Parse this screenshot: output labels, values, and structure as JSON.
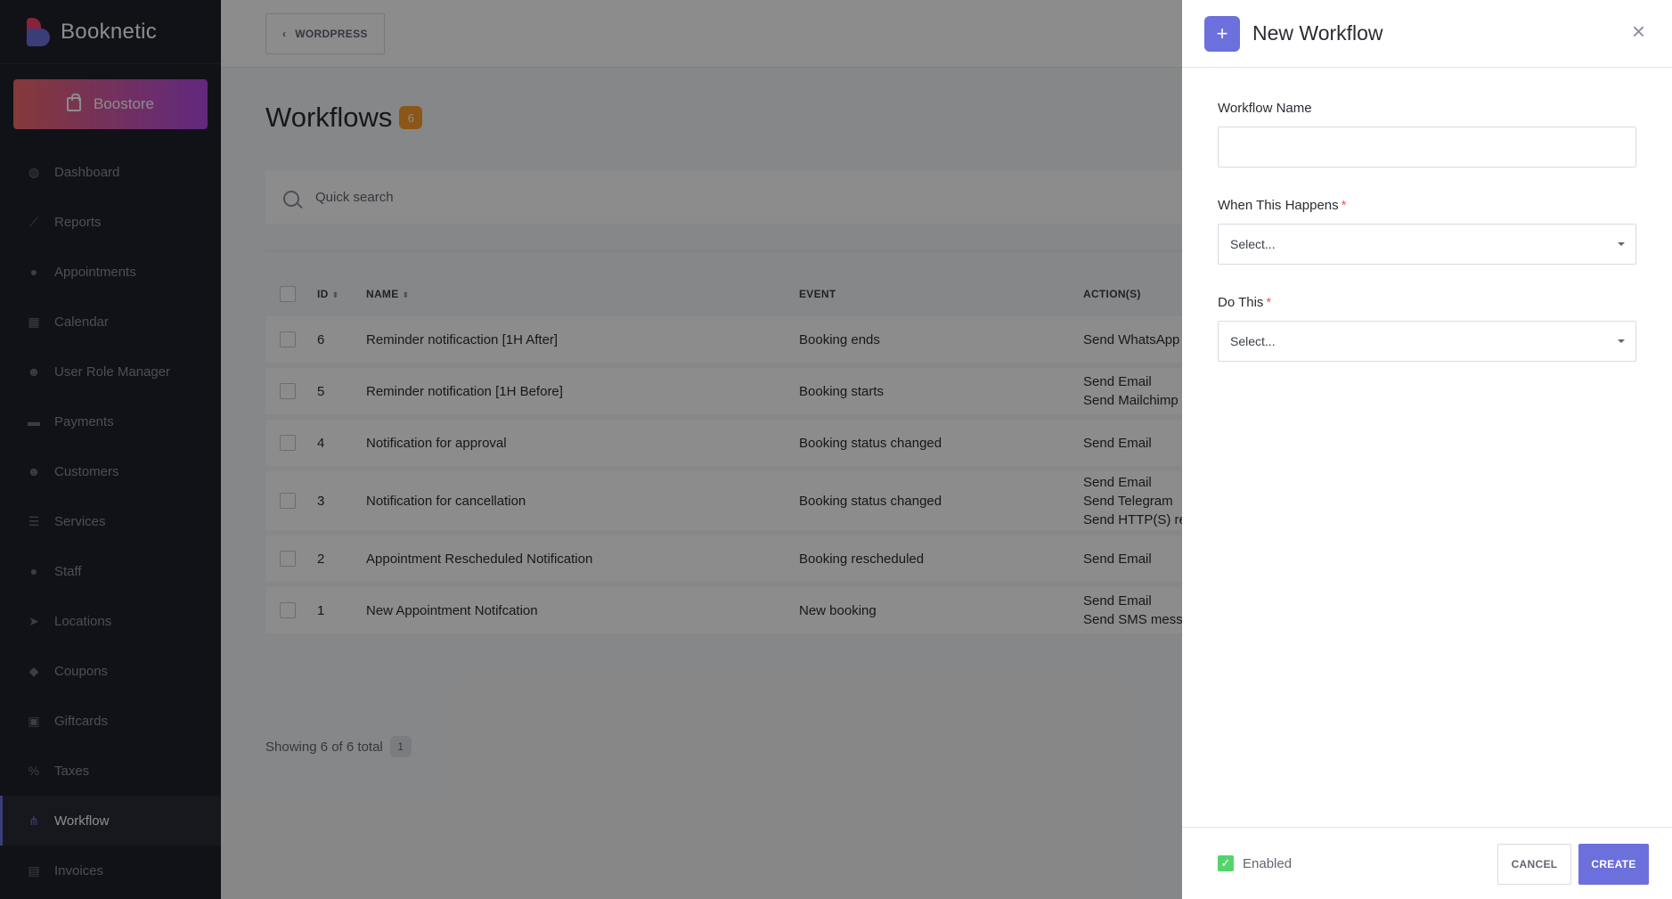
{
  "brand": {
    "name": "Booknetic"
  },
  "sidebar": {
    "boostore_label": "Boostore",
    "items": [
      {
        "label": "Dashboard",
        "icon": "dashboard-icon",
        "glyph": "◍"
      },
      {
        "label": "Reports",
        "icon": "chart-icon",
        "glyph": "⟋"
      },
      {
        "label": "Appointments",
        "icon": "clock-icon",
        "glyph": "●"
      },
      {
        "label": "Calendar",
        "icon": "calendar-icon",
        "glyph": "▦"
      },
      {
        "label": "User Role Manager",
        "icon": "user-role-icon",
        "glyph": "☻"
      },
      {
        "label": "Payments",
        "icon": "wallet-icon",
        "glyph": "▬"
      },
      {
        "label": "Customers",
        "icon": "users-icon",
        "glyph": "☻"
      },
      {
        "label": "Services",
        "icon": "list-icon",
        "glyph": "☰"
      },
      {
        "label": "Staff",
        "icon": "person-icon",
        "glyph": "●"
      },
      {
        "label": "Locations",
        "icon": "location-arrow-icon",
        "glyph": "➤"
      },
      {
        "label": "Coupons",
        "icon": "tag-icon",
        "glyph": "◆"
      },
      {
        "label": "Giftcards",
        "icon": "gift-icon",
        "glyph": "▣"
      },
      {
        "label": "Taxes",
        "icon": "percent-icon",
        "glyph": "%"
      },
      {
        "label": "Workflow",
        "icon": "workflow-icon",
        "glyph": "⋔",
        "active": true
      },
      {
        "label": "Invoices",
        "icon": "invoice-icon",
        "glyph": "▤"
      }
    ]
  },
  "topbar": {
    "wordpress_label": "WORDPRESS"
  },
  "page": {
    "title": "Workflows",
    "count": "6"
  },
  "search": {
    "placeholder": "Quick search"
  },
  "table": {
    "headers": {
      "id": "ID",
      "name": "NAME",
      "event": "EVENT",
      "actions": "ACTION(S)"
    },
    "rows": [
      {
        "id": "6",
        "name": "Reminder notificaction [1H After]",
        "event": "Booking ends",
        "actions": [
          "Send WhatsApp"
        ]
      },
      {
        "id": "5",
        "name": "Reminder notification [1H Before]",
        "event": "Booking starts",
        "actions": [
          "Send Email",
          "Send Mailchimp"
        ]
      },
      {
        "id": "4",
        "name": "Notification for approval",
        "event": "Booking status changed",
        "actions": [
          "Send Email"
        ]
      },
      {
        "id": "3",
        "name": "Notification for cancellation",
        "event": "Booking status changed",
        "actions": [
          "Send Email",
          "Send Telegram",
          "Send HTTP(S) re"
        ]
      },
      {
        "id": "2",
        "name": "Appointment Rescheduled Notification",
        "event": "Booking rescheduled",
        "actions": [
          "Send Email"
        ]
      },
      {
        "id": "1",
        "name": "New Appointment Notifcation",
        "event": "New booking",
        "actions": [
          "Send Email",
          "Send SMS mess"
        ]
      }
    ]
  },
  "footer": {
    "showing": "Showing 6 of 6 total",
    "page": "1"
  },
  "panel": {
    "title": "New Workflow",
    "name_label": "Workflow Name",
    "name_value": "",
    "when_label": "When This Happens",
    "when_placeholder": "Select...",
    "do_label": "Do This",
    "do_placeholder": "Select...",
    "required_mark": "*",
    "enabled_label": "Enabled",
    "cancel_label": "CANCEL",
    "create_label": "CREATE"
  },
  "colors": {
    "accent": "#6c70dc",
    "badge": "#fc9e2c",
    "enabled": "#53d56c",
    "sidebar": "#1f222c"
  }
}
